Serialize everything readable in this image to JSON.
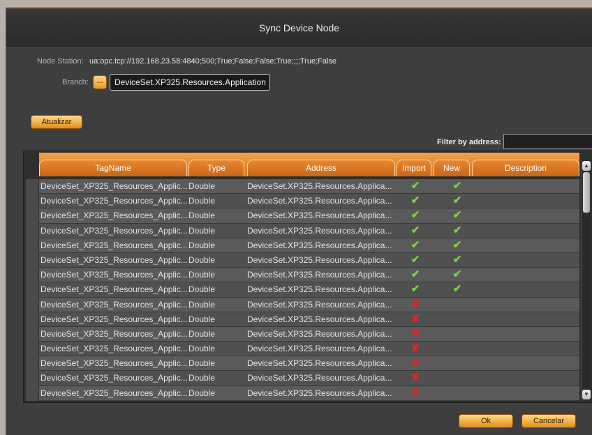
{
  "dialog": {
    "title": "Sync Device Node",
    "node_station_label": "Node Station:",
    "node_station_value": "ua:opc.tcp://192.168.23.58:4840;500;True;False;False;True;;;;True;False",
    "branch_label": "Branch:",
    "branch_browse_label": "...",
    "branch_value": "DeviceSet.XP325.Resources.Application",
    "refresh_label": "Atualizar",
    "filter_label": "Filter by address:",
    "filter_value": "",
    "ok_label": "Ok",
    "cancel_label": "Cancelar"
  },
  "grid": {
    "columns": [
      "TagName",
      "Type",
      "Address",
      "Import",
      "New",
      "Description"
    ],
    "rows": [
      {
        "tag": "DeviceSet_XP325_Resources_Applic...",
        "type": "Double",
        "address": "DeviceSet.XP325.Resources.Applica...",
        "import": true,
        "new": true
      },
      {
        "tag": "DeviceSet_XP325_Resources_Applic...",
        "type": "Double",
        "address": "DeviceSet.XP325.Resources.Applica...",
        "import": true,
        "new": true
      },
      {
        "tag": "DeviceSet_XP325_Resources_Applic...",
        "type": "Double",
        "address": "DeviceSet.XP325.Resources.Applica...",
        "import": true,
        "new": true
      },
      {
        "tag": "DeviceSet_XP325_Resources_Applic...",
        "type": "Double",
        "address": "DeviceSet.XP325.Resources.Applica...",
        "import": true,
        "new": true
      },
      {
        "tag": "DeviceSet_XP325_Resources_Applic...",
        "type": "Double",
        "address": "DeviceSet.XP325.Resources.Applica...",
        "import": true,
        "new": true
      },
      {
        "tag": "DeviceSet_XP325_Resources_Applic...",
        "type": "Double",
        "address": "DeviceSet.XP325.Resources.Applica...",
        "import": true,
        "new": true
      },
      {
        "tag": "DeviceSet_XP325_Resources_Applic...",
        "type": "Double",
        "address": "DeviceSet.XP325.Resources.Applica...",
        "import": true,
        "new": true
      },
      {
        "tag": "DeviceSet_XP325_Resources_Applic...",
        "type": "Double",
        "address": "DeviceSet.XP325.Resources.Applica...",
        "import": true,
        "new": true
      },
      {
        "tag": "DeviceSet_XP325_Resources_Applic...",
        "type": "Double",
        "address": "DeviceSet.XP325.Resources.Applica...",
        "import": false,
        "new": false
      },
      {
        "tag": "DeviceSet_XP325_Resources_Applic...",
        "type": "Double",
        "address": "DeviceSet.XP325.Resources.Applica...",
        "import": false,
        "new": false
      },
      {
        "tag": "DeviceSet_XP325_Resources_Applic...",
        "type": "Double",
        "address": "DeviceSet.XP325.Resources.Applica...",
        "import": false,
        "new": false
      },
      {
        "tag": "DeviceSet_XP325_Resources_Applic...",
        "type": "Double",
        "address": "DeviceSet.XP325.Resources.Applica...",
        "import": false,
        "new": false
      },
      {
        "tag": "DeviceSet_XP325_Resources_Applic...",
        "type": "Double",
        "address": "DeviceSet.XP325.Resources.Applica...",
        "import": false,
        "new": false
      },
      {
        "tag": "DeviceSet_XP325_Resources_Applic...",
        "type": "Double",
        "address": "DeviceSet.XP325.Resources.Applica...",
        "import": false,
        "new": false
      },
      {
        "tag": "DeviceSet_XP325_Resources_Applic...",
        "type": "Double",
        "address": "DeviceSet.XP325.Resources.Applica...",
        "import": false,
        "new": false
      }
    ]
  },
  "icons": {
    "check": "check-icon",
    "cross": "cross-icon",
    "scroll_up": "chevron-up-icon",
    "scroll_down": "chevron-down-icon"
  },
  "colors": {
    "accent": "#e8872e",
    "check": "#7bd63b",
    "cross": "#e32424"
  }
}
